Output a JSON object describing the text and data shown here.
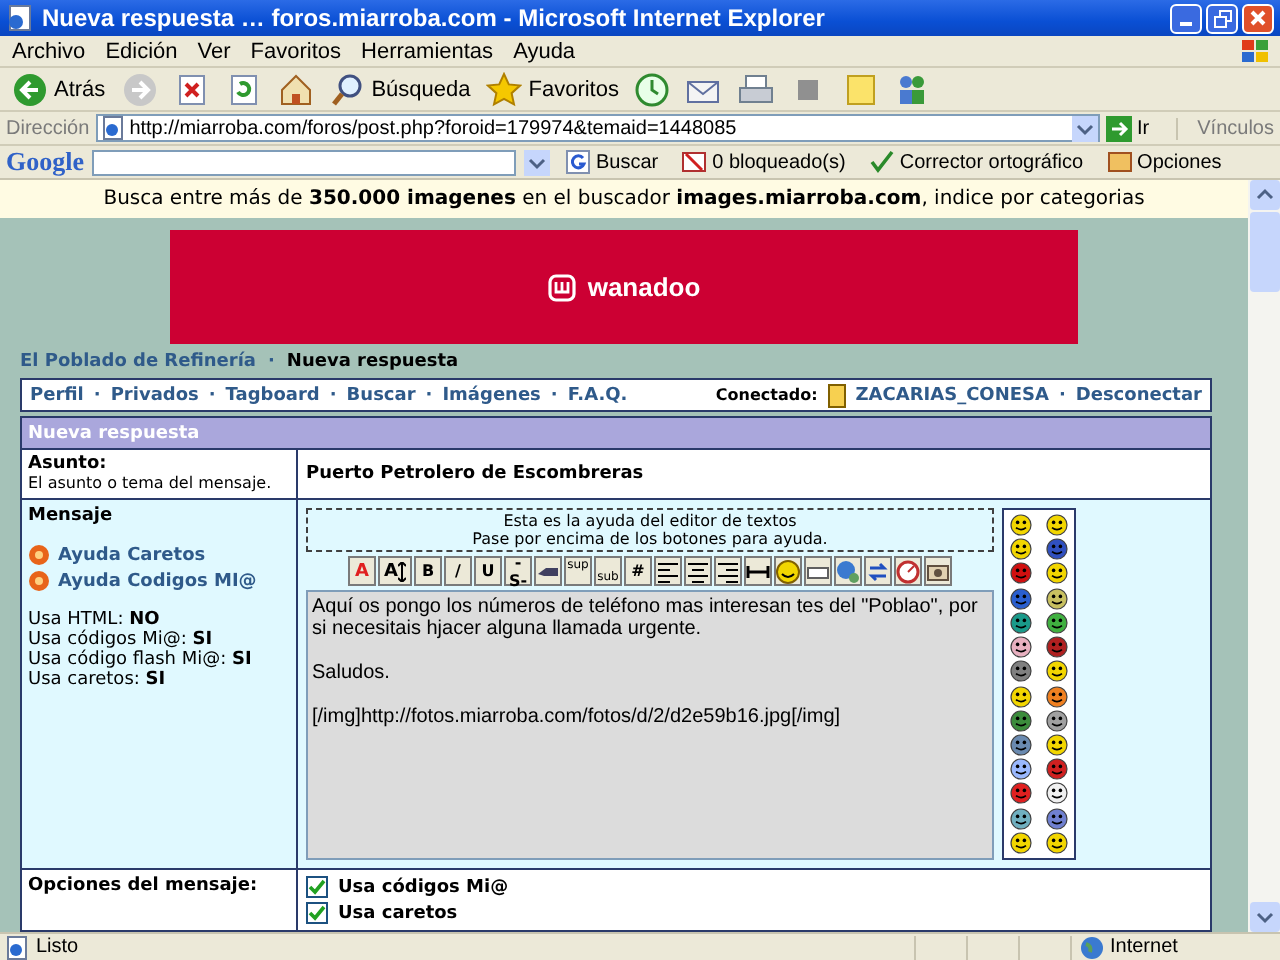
{
  "window": {
    "title": "Nueva respuesta … foros.miarroba.com - Microsoft Internet Explorer"
  },
  "menu": [
    "Archivo",
    "Edición",
    "Ver",
    "Favoritos",
    "Herramientas",
    "Ayuda"
  ],
  "toolbar": [
    {
      "kind": "back",
      "label": "Atrás"
    },
    {
      "kind": "forward"
    },
    {
      "kind": "stop"
    },
    {
      "kind": "refresh"
    },
    {
      "kind": "home"
    },
    {
      "kind": "search",
      "label": "Búsqueda"
    },
    {
      "kind": "favorites",
      "label": "Favoritos"
    },
    {
      "kind": "history"
    },
    {
      "kind": "mail"
    },
    {
      "kind": "print"
    },
    {
      "kind": "edit"
    },
    {
      "kind": "note"
    },
    {
      "kind": "messenger"
    }
  ],
  "address_bar": {
    "label": "Dirección",
    "url": "http://miarroba.com/foros/post.php?foroid=179974&temaid=1448085",
    "go": "Ir",
    "links": "Vínculos"
  },
  "google_bar": {
    "logo": "Google",
    "search": "Buscar",
    "blocked": "0 bloqueado(s)",
    "spell": "Corrector ortográfico",
    "options": "Opciones"
  },
  "promo": "Busca entre más de **350.000 imagenes** en el buscador **images.miarroba.com**, indice por categorias",
  "ad": {
    "brand": "wanadoo"
  },
  "breadcrumb": [
    {
      "label": "El Poblado de Refinería",
      "current": false
    },
    {
      "label": "Nueva respuesta",
      "current": true
    }
  ],
  "separator": "·",
  "nav": [
    "Perfil",
    "Privados",
    "Tagboard",
    "Buscar",
    "Imágenes",
    "F.A.Q."
  ],
  "user": {
    "label": "Conectado:",
    "name": "ZACARIAS_CONESA",
    "logout": "Desconectar"
  },
  "form": {
    "title": "Nueva respuesta",
    "subject": {
      "label": "Asunto:",
      "hint": "El asunto o tema del mensaje.",
      "value": "Puerto Petrolero de Escombreras"
    },
    "message": {
      "label": "Mensaje",
      "help_links": [
        "Ayuda Caretos",
        "Ayuda Codigos MI@"
      ],
      "settings": [
        "Usa HTML: **NO**",
        "Usa códigos Mi@: **SI**",
        "Usa código flash Mi@: **SI**",
        "Usa caretos: **SI**"
      ],
      "editor_help": [
        "Esta es la ayuda del editor de textos",
        "Pase por encima de los botones para ayuda."
      ],
      "editor_buttons": [
        {
          "kind": "font-color",
          "label": "A"
        },
        {
          "kind": "font-size",
          "label": "A"
        },
        {
          "kind": "text",
          "label": "B"
        },
        {
          "kind": "text",
          "label": "/"
        },
        {
          "kind": "text",
          "label": "U"
        },
        {
          "kind": "text",
          "label": "-S-"
        },
        {
          "kind": "quote"
        },
        {
          "kind": "sup",
          "label": "sup"
        },
        {
          "kind": "sub",
          "label": "sub"
        },
        {
          "kind": "text",
          "label": "#"
        },
        {
          "kind": "align-left"
        },
        {
          "kind": "align-center"
        },
        {
          "kind": "align-right"
        },
        {
          "kind": "rule"
        },
        {
          "kind": "smiley"
        },
        {
          "kind": "code"
        },
        {
          "kind": "globe"
        },
        {
          "kind": "swap"
        },
        {
          "kind": "dial"
        },
        {
          "kind": "camera"
        }
      ],
      "body": "Aquí os pongo los números de teléfono mas interesan tes del \"Poblao\", por si necesitais hjacer alguna llamada urgente.\n\nSaludos.\n\n[/img]http://fotos.miarroba.com/fotos/d/2/d2e59b16.jpg[/img]"
    },
    "options": {
      "label": "Opciones del mensaje:",
      "items": [
        {
          "label": "Usa códigos Mi@",
          "checked": true
        },
        {
          "label": "Usa caretos",
          "checked": true
        }
      ]
    }
  },
  "status_bar": {
    "text": "Listo",
    "zone": "Internet"
  }
}
